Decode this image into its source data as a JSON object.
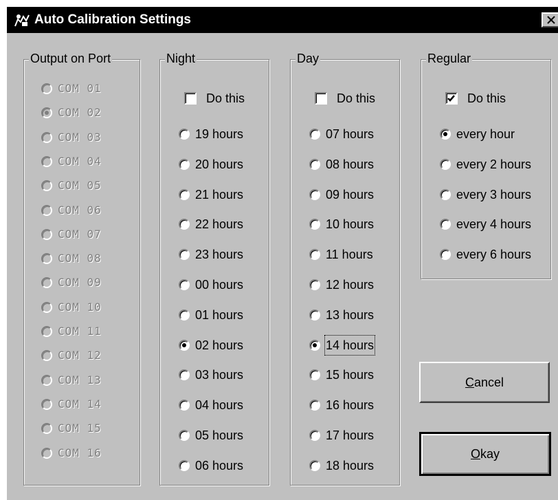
{
  "window": {
    "title": "Auto Calibration Settings"
  },
  "groups": {
    "port": {
      "legend": "Output on Port",
      "options": [
        "COM 01",
        "COM 02",
        "COM 03",
        "COM 04",
        "COM 05",
        "COM 06",
        "COM 07",
        "COM 08",
        "COM 09",
        "COM 10",
        "COM 11",
        "COM 12",
        "COM 13",
        "COM 14",
        "COM 15",
        "COM 16"
      ],
      "selected": "COM 02",
      "enabled": false
    },
    "night": {
      "legend": "Night",
      "do_this_label": "Do this",
      "do_this_checked": false,
      "options": [
        "19 hours",
        "20 hours",
        "21 hours",
        "22 hours",
        "23 hours",
        "00 hours",
        "01 hours",
        "02 hours",
        "03 hours",
        "04 hours",
        "05 hours",
        "06 hours"
      ],
      "selected": "02 hours"
    },
    "day": {
      "legend": "Day",
      "do_this_label": "Do this",
      "do_this_checked": false,
      "options": [
        "07 hours",
        "08 hours",
        "09 hours",
        "10 hours",
        "11 hours",
        "12 hours",
        "13 hours",
        "14 hours",
        "15 hours",
        "16 hours",
        "17 hours",
        "18 hours"
      ],
      "selected": "14 hours",
      "focused": "14 hours"
    },
    "regular": {
      "legend": "Regular",
      "do_this_label": "Do this",
      "do_this_checked": true,
      "options": [
        "every hour",
        "every 2 hours",
        "every 3 hours",
        "every 4 hours",
        "every 6 hours"
      ],
      "selected": "every hour"
    }
  },
  "buttons": {
    "cancel": {
      "label": "Cancel",
      "mnemonic": "C",
      "rest": "ancel"
    },
    "okay": {
      "label": "Okay",
      "mnemonic": "O",
      "rest": "kay"
    }
  }
}
